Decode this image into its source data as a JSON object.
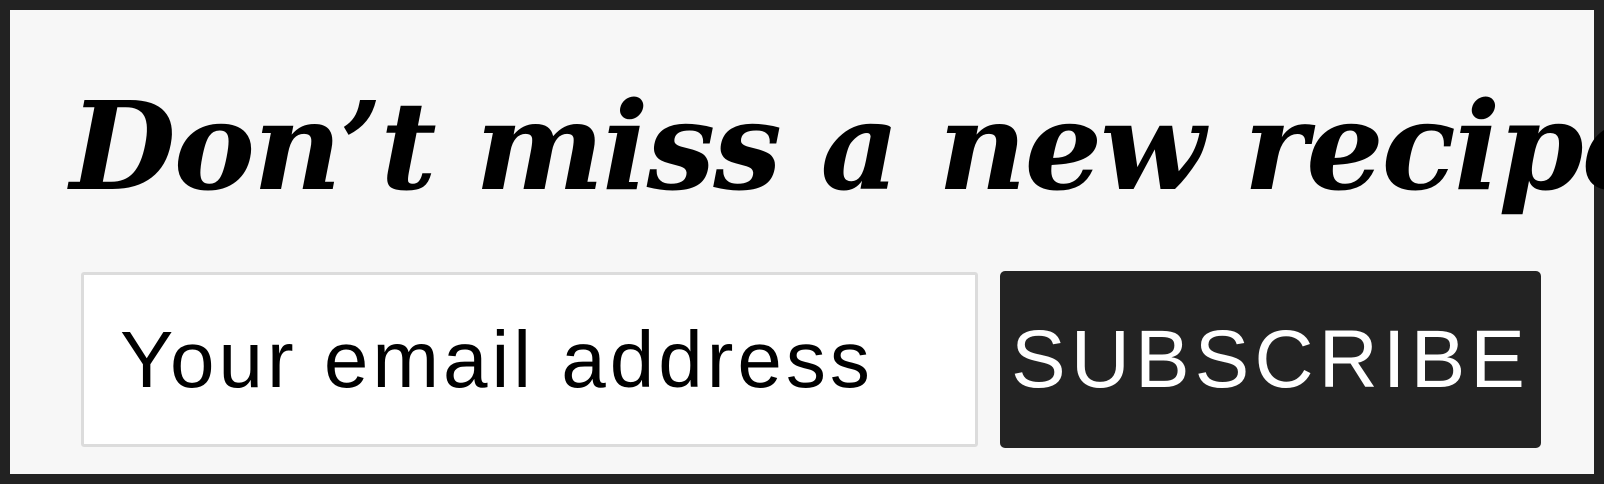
{
  "signup": {
    "headline": "Don’t miss a new recipe",
    "email_placeholder": "Your email address",
    "email_value": "",
    "subscribe_label": "SUBSCRIBE"
  },
  "colors": {
    "frame": "#222222",
    "background": "#f7f7f7",
    "button": "#232323",
    "button_text": "#ffffff",
    "input_border": "#dcdcdc"
  }
}
